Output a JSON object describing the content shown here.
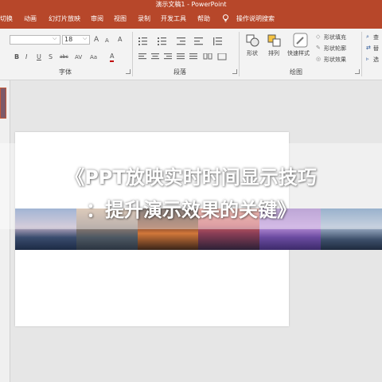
{
  "window": {
    "title": "演示文稿1 - PowerPoint"
  },
  "menu": {
    "items": [
      "切换",
      "动画",
      "幻灯片放映",
      "审阅",
      "视图",
      "录制",
      "开发工具",
      "帮助"
    ],
    "search_hint": "操作说明搜索"
  },
  "ribbon": {
    "font": {
      "size_value": "18",
      "label": "字体",
      "grow_glyph": "A",
      "shrink_glyph": "A",
      "clear_glyph": "A",
      "bold": "B",
      "italic": "I",
      "underline": "U",
      "shadow": "S",
      "strike": "abc",
      "spacing": "AV",
      "case": "Aa",
      "color": "A"
    },
    "paragraph": {
      "label": "段落"
    },
    "drawing": {
      "label": "绘图",
      "shape_label": "形状",
      "arrange_label": "排列",
      "quickstyle_label": "快速样式",
      "fill_label": "形状填充",
      "outline_label": "形状轮廓",
      "effect_label": "形状效果"
    },
    "editing": {
      "items": [
        "查",
        "替",
        "选"
      ]
    }
  },
  "overlay": {
    "heading_line1": "《PPT放映实时时间显示技巧",
    "heading_line2": "：提升演示效果的关键》"
  },
  "colors": {
    "accent": "#b7472a",
    "ribbon_bg": "#f3f3f3",
    "canvas_bg": "#e6e6e6"
  },
  "icons": [
    "lightbulb-icon",
    "chevron-down-icon",
    "bullets-icon",
    "numbering-icon",
    "align-icon",
    "shapes-icon",
    "arrange-icon",
    "quick-styles-icon",
    "paint-bucket-icon",
    "pencil-icon",
    "effects-icon"
  ]
}
